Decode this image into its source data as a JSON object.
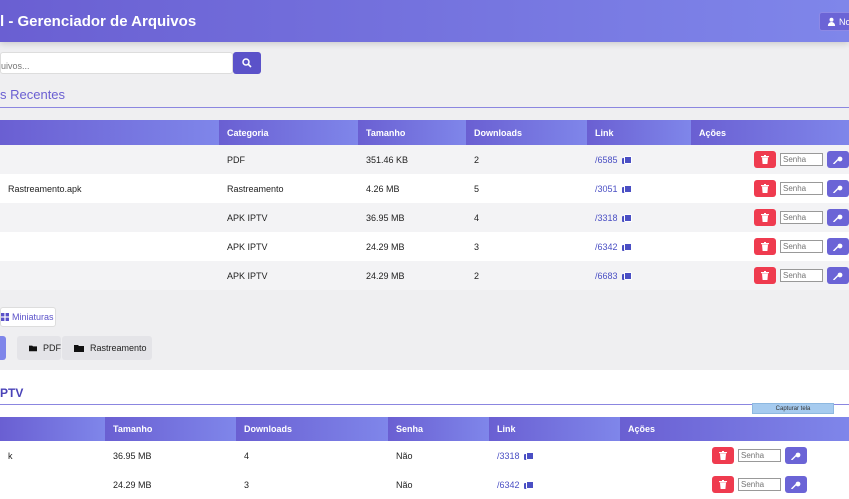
{
  "header": {
    "title": "l - Gerenciador de Arquivos",
    "new_button_label": "No"
  },
  "search": {
    "placeholder": "uivos...",
    "button_icon": "search-icon"
  },
  "recent": {
    "title": "s Recentes",
    "columns": [
      "",
      "Categoria",
      "Tamanho",
      "Downloads",
      "Link",
      "Ações"
    ],
    "rows": [
      {
        "name": "",
        "category": "PDF",
        "size": "351.46 KB",
        "downloads": "2",
        "link": "/6585"
      },
      {
        "name": "Rastreamento.apk",
        "category": "Rastreamento",
        "size": "4.26 MB",
        "downloads": "5",
        "link": "/3051"
      },
      {
        "name": "",
        "category": "APK IPTV",
        "size": "36.95 MB",
        "downloads": "4",
        "link": "/3318"
      },
      {
        "name": "",
        "category": "APK IPTV",
        "size": "24.29 MB",
        "downloads": "3",
        "link": "/6342"
      },
      {
        "name": "",
        "category": "APK IPTV",
        "size": "24.29 MB",
        "downloads": "2",
        "link": "/6683"
      }
    ],
    "password_placeholder": "Senha"
  },
  "view": {
    "thumbnails_label": "Miniaturas"
  },
  "filters": [
    {
      "label": "PDF"
    },
    {
      "label": "Rastreamento"
    }
  ],
  "iptv": {
    "title": "PTV",
    "capture_label": "Capturar tela",
    "columns": [
      "",
      "Tamanho",
      "Downloads",
      "Senha",
      "Link",
      "Ações"
    ],
    "rows": [
      {
        "name": "k",
        "size": "36.95 MB",
        "downloads": "4",
        "password": "Não",
        "link": "/3318"
      },
      {
        "name": "",
        "size": "24.29 MB",
        "downloads": "3",
        "password": "Não",
        "link": "/6342"
      }
    ],
    "password_placeholder": "Senha"
  },
  "colors": {
    "accent": "#6a5fd2",
    "delete": "#ef3b4f"
  }
}
